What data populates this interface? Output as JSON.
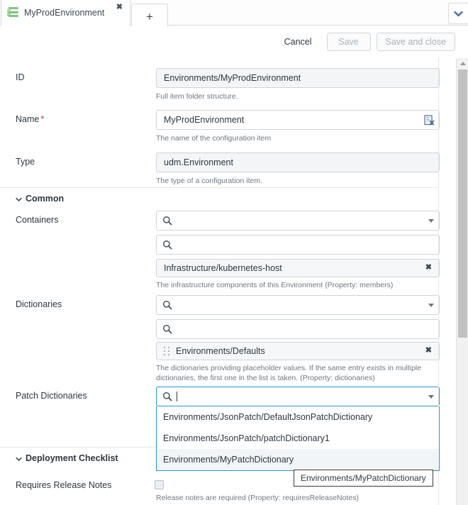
{
  "window": {
    "tab": {
      "label": "MyProdEnvironment",
      "icon": "stack-icon",
      "close_label": "✖",
      "new_tab_label": "+",
      "overflow_icon": "chevron-down-icon"
    }
  },
  "actionbar": {
    "cancel_label": "Cancel",
    "save_label": "Save",
    "save_and_close_label": "Save and close"
  },
  "form": {
    "fields": [
      {
        "label": "ID",
        "required": false,
        "value": "Environments/MyProdEnvironment",
        "help": "Full item folder structure.",
        "readonly": true
      },
      {
        "label": "Name",
        "required": true,
        "value": "MyProdEnvironment",
        "help": "The name of the configuration item",
        "readonly": false,
        "action_icon": "clear-field-icon"
      },
      {
        "label": "Type",
        "required": false,
        "value": "udm.Environment",
        "help": "The type of a configuration item.",
        "readonly": true
      }
    ],
    "sections": [
      {
        "title": "Common",
        "expanded": true,
        "chevron": "chevron-down-icon"
      },
      {
        "title": "Deployment Checklist",
        "expanded": true,
        "chevron": "chevron-down-icon"
      }
    ],
    "containers": {
      "label": "Containers",
      "search_value": "",
      "filter_value": "",
      "search_icon": "search-icon",
      "caret_icon": "caret-down-icon",
      "items": [
        {
          "value": "Infrastructure/kubernetes-host",
          "remove_label": "✖"
        }
      ],
      "help": "The infrastructure components of this Environment (Property: members)"
    },
    "dictionaries": {
      "label": "Dictionaries",
      "search_value": "",
      "filter_value": "",
      "search_icon": "search-icon",
      "caret_icon": "caret-down-icon",
      "items": [
        {
          "value": "Environments/Defaults",
          "remove_label": "✖",
          "drag_icon": "drag-handle-icon"
        }
      ],
      "help": "The dictionaries providing placeholder values. If the same entry exists in multiple dictionaries, the first one in the list is taken. (Property: dictionaries)"
    },
    "patch_dictionaries": {
      "label": "Patch Dictionaries",
      "search_value": "",
      "search_icon": "search-icon",
      "caret_icon": "caret-down-icon",
      "focused": true,
      "options": [
        "Environments/JsonPatch/DefaultJsonPatchDictionary",
        "Environments/JsonPatch/patchDictionary1",
        "Environments/MyPatchDictionary"
      ],
      "highlighted_index": 2
    },
    "requires_release_notes": {
      "label": "Requires Release Notes",
      "checked": false,
      "help": "Release notes are required (Property: requiresReleaseNotes)"
    }
  },
  "tooltip": {
    "text": "Environments/MyPatchDictionary"
  },
  "colors": {
    "accent": "#2398c9",
    "icon_blue": "#4a6f9c",
    "tab_icon_green": "#7cc57c",
    "required_red": "#c0392b",
    "text": "#2c3742",
    "help_text": "#6c7782",
    "border": "#cdd4da",
    "readonly_bg": "#f3f5f7",
    "highlight_bg": "#f2f5f8",
    "scrollbar_thumb": "#c1c1c1"
  }
}
